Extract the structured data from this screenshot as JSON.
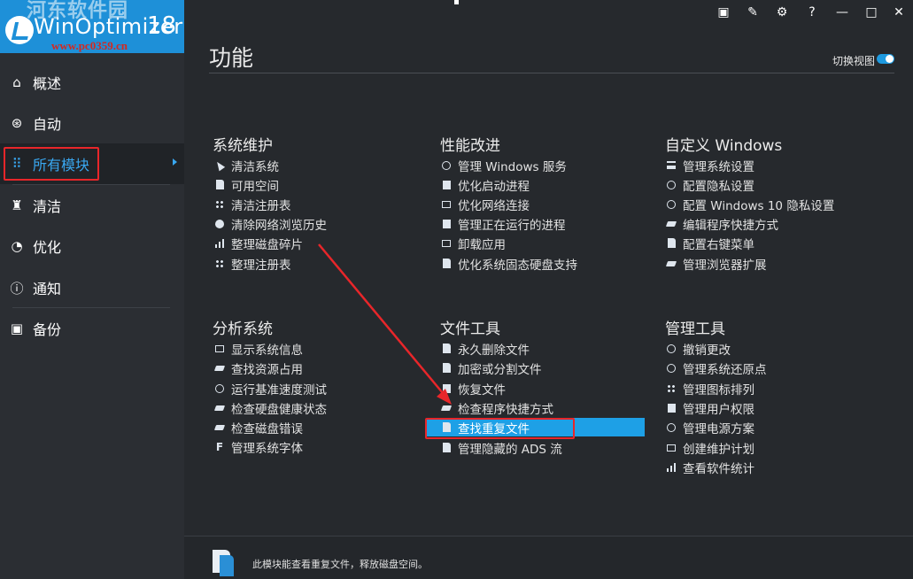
{
  "app": {
    "logo_name": "WinOptimizer",
    "logo_version": "18",
    "logo_watermark": "河东软件园",
    "logo_url": "www.pc0359.cn"
  },
  "titlebar": {
    "buttons": [
      {
        "name": "feedback-icon",
        "glyph": "▣"
      },
      {
        "name": "edit-icon",
        "glyph": "✎"
      },
      {
        "name": "gear-icon",
        "glyph": "⚙"
      },
      {
        "name": "help-icon",
        "glyph": "?"
      },
      {
        "name": "minimize-icon",
        "glyph": "—"
      },
      {
        "name": "maximize-icon",
        "glyph": "□"
      },
      {
        "name": "close-icon",
        "glyph": "✕"
      }
    ]
  },
  "sidebar": {
    "items": [
      {
        "label": "概述",
        "icon": "home-icon",
        "glyph": "⌂"
      },
      {
        "label": "自动",
        "icon": "automation-icon",
        "glyph": "⊛"
      },
      {
        "label": "所有模块",
        "icon": "grid-icon",
        "glyph": "⠿"
      },
      {
        "label": "清洁",
        "icon": "broom-icon",
        "glyph": "♜"
      },
      {
        "label": "优化",
        "icon": "gauge-icon",
        "glyph": "◔"
      },
      {
        "label": "通知",
        "icon": "info-icon",
        "glyph": "ⓘ"
      },
      {
        "label": "备份",
        "icon": "backup-icon",
        "glyph": "▣"
      }
    ],
    "active_index": 2
  },
  "main": {
    "title": "功能",
    "toggle_label": "切换视图",
    "sections": [
      {
        "heading": "系统维护",
        "items": [
          "清洁系统",
          "可用空间",
          "清洁注册表",
          "清除网络浏览历史",
          "整理磁盘碎片",
          "整理注册表"
        ]
      },
      {
        "heading": "性能改进",
        "items": [
          "管理 Windows 服务",
          "优化启动进程",
          "优化网络连接",
          "管理正在运行的进程",
          "卸载应用",
          "优化系统固态硬盘支持"
        ]
      },
      {
        "heading": "自定义 Windows",
        "items": [
          "管理系统设置",
          "配置隐私设置",
          "配置 Windows 10 隐私设置",
          "编辑程序快捷方式",
          "配置右键菜单",
          "管理浏览器扩展"
        ]
      },
      {
        "heading": "分析系统",
        "items": [
          "显示系统信息",
          "查找资源占用",
          "运行基准速度测试",
          "检查硬盘健康状态",
          "检查磁盘错误",
          "管理系统字体"
        ]
      },
      {
        "heading": "文件工具",
        "items": [
          "永久删除文件",
          "加密或分割文件",
          "恢复文件",
          "检查程序快捷方式",
          "查找重复文件",
          "管理隐藏的 ADS 流"
        ],
        "selected_index": 4
      },
      {
        "heading": "管理工具",
        "items": [
          "撤销更改",
          "管理系统还原点",
          "管理图标排列",
          "管理用户权限",
          "管理电源方案",
          "创建维护计划",
          "查看软件统计"
        ]
      }
    ]
  },
  "footer": {
    "description": "此模块能查看重复文件，释放磁盘空间。"
  },
  "colors": {
    "accent": "#1ea0e6",
    "annotation_red": "#e8262a",
    "background": "#26292d"
  }
}
